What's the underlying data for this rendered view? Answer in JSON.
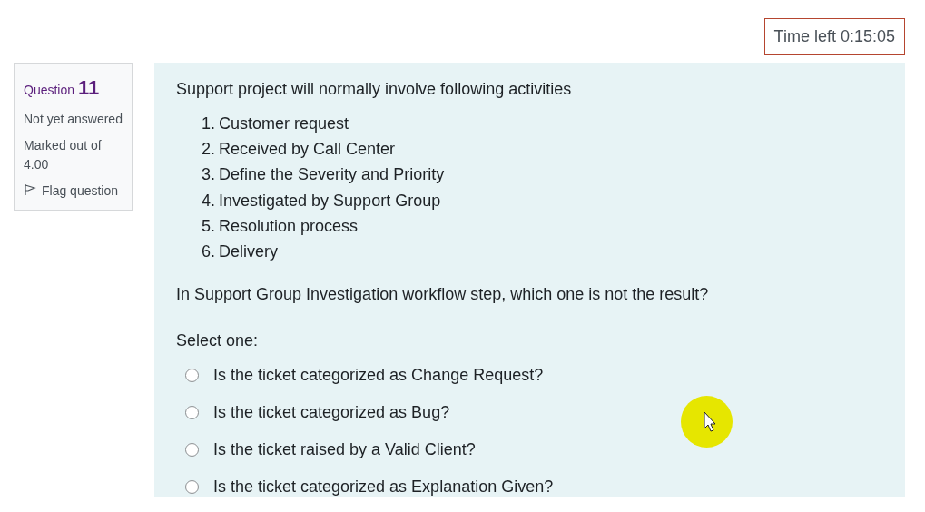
{
  "timer": {
    "text": "Time left 0:15:05"
  },
  "question_info": {
    "label": "Question",
    "number": "11",
    "state": "Not yet answered",
    "marks": "Marked out of 4.00",
    "flag": {
      "label": "Flag question",
      "flagged": false
    }
  },
  "question": {
    "intro": "Support project will normally involve following activities",
    "steps": [
      {
        "number": "1.",
        "text": "Customer request"
      },
      {
        "number": "2.",
        "text": "Received by Call Center"
      },
      {
        "number": "3.",
        "text": "Define the Severity and Priority"
      },
      {
        "number": "4.",
        "text": "Investigated by Support Group"
      },
      {
        "number": "5.",
        "text": "Resolution process"
      },
      {
        "number": "6.",
        "text": "Delivery"
      }
    ],
    "prompt": "In Support Group Investigation workflow step, which one is not the result?",
    "select_label": "Select one:",
    "options": [
      {
        "text": "Is the ticket categorized as Change Request?",
        "selected": false
      },
      {
        "text": "Is the ticket categorized as Bug?",
        "selected": false
      },
      {
        "text": "Is the ticket raised by a Valid Client?",
        "selected": false
      },
      {
        "text": "Is the ticket categorized as Explanation Given?",
        "selected": false
      }
    ]
  }
}
